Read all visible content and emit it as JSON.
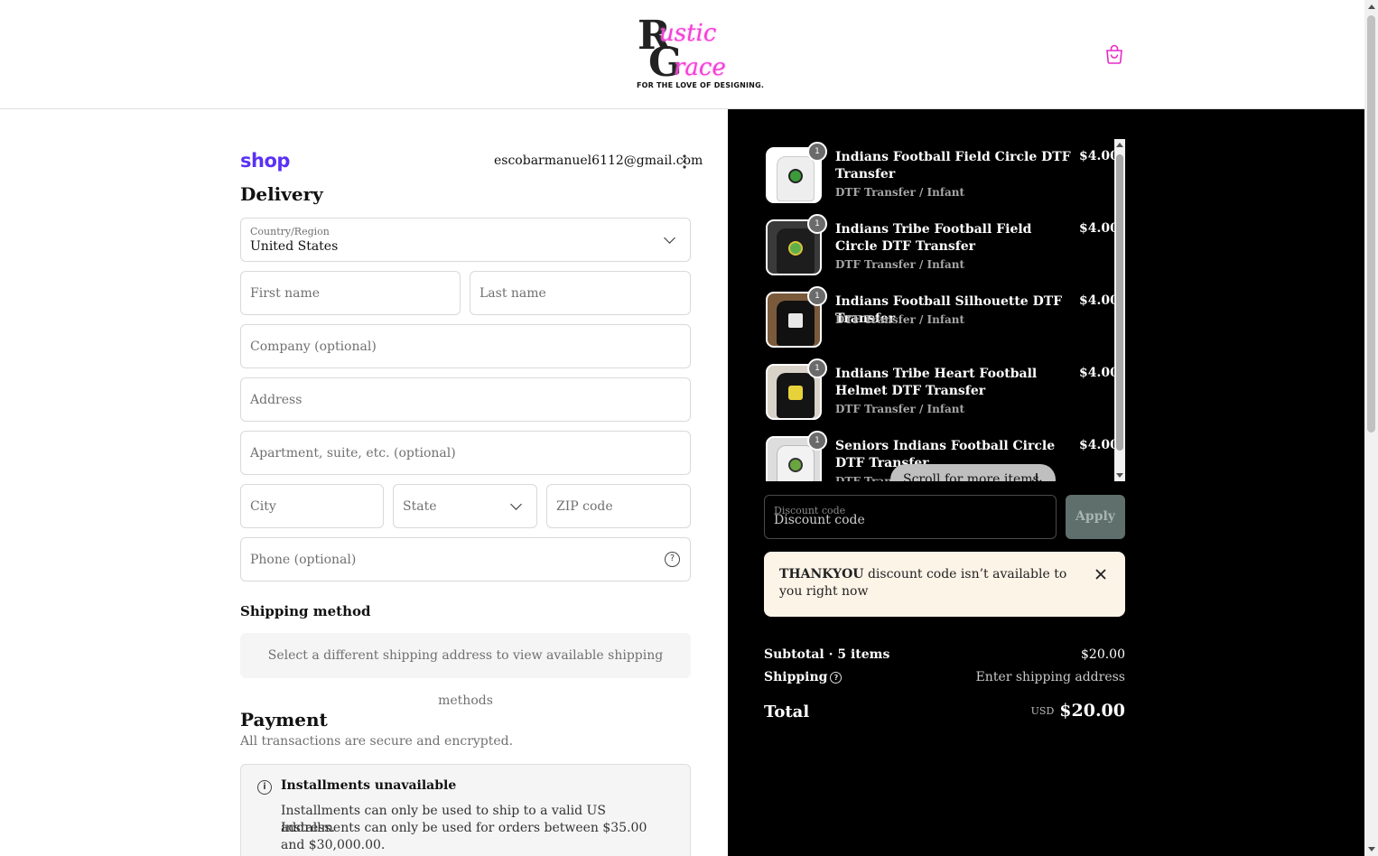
{
  "header": {
    "logo_letters_top": "R",
    "logo_script_top": "ustic",
    "logo_letters_bottom": "G",
    "logo_script_bottom": "race",
    "logo_tagline": "FOR THE LOVE OF DESIGNING."
  },
  "account": {
    "shop_brand": "shop",
    "email": "escobarmanuel6112@gmail.com"
  },
  "delivery": {
    "heading": "Delivery",
    "country_label": "Country/Region",
    "country_value": "United States",
    "first_name_placeholder": "First name",
    "last_name_placeholder": "Last name",
    "company_placeholder": "Company (optional)",
    "address_placeholder": "Address",
    "apartment_placeholder": "Apartment, suite, etc. (optional)",
    "city_placeholder": "City",
    "state_placeholder": "State",
    "zip_placeholder": "ZIP code",
    "phone_placeholder": "Phone (optional)"
  },
  "shipping_method": {
    "heading": "Shipping method",
    "note": "Select a different shipping address to view available shipping methods"
  },
  "payment": {
    "heading": "Payment",
    "subtitle": "All transactions are secure and encrypted.",
    "notice_title": "Installments unavailable",
    "notice_line1": "Installments can only be used to ship to a valid US address.",
    "notice_line2": "Installments can only be used for orders between $35.00 and $30,000.00."
  },
  "cart": {
    "items": [
      {
        "name": "Indians Football Field Circle DTF Transfer",
        "variant": "DTF Transfer / Infant",
        "price": "$4.00",
        "qty": "1"
      },
      {
        "name": "Indians Tribe Football Field Circle DTF Transfer",
        "variant": "DTF Transfer / Infant",
        "price": "$4.00",
        "qty": "1"
      },
      {
        "name": "Indians Football Silhouette DTF Transfer",
        "variant": "DTF Transfer / Infant",
        "price": "$4.00",
        "qty": "1"
      },
      {
        "name": "Indians Tribe Heart Football Helmet DTF Transfer",
        "variant": "DTF Transfer / Infant",
        "price": "$4.00",
        "qty": "1"
      },
      {
        "name": "Seniors Indians Football Circle DTF Transfer",
        "variant": "DTF Transfer / Infant",
        "price": "$4.00",
        "qty": "1"
      }
    ],
    "scroll_hint": "Scroll for more items",
    "discount_label": "Discount code",
    "discount_placeholder": "Discount code",
    "apply_label": "Apply",
    "notice_code": "THANKYOU",
    "notice_text": " discount code isn’t available to you right now",
    "subtotal_label": "Subtotal · 5 items",
    "subtotal_value": "$20.00",
    "shipping_label": "Shipping",
    "shipping_value": "Enter shipping address",
    "total_label": "Total",
    "total_currency": "USD",
    "total_value": "$20.00"
  },
  "colors": {
    "shop_brand": "#5a31f4",
    "logo_pink": "#f43fd6",
    "summary_bg": "#000000",
    "notice_bg": "#fdf4e8",
    "apply_bg": "#5f6f6b"
  }
}
